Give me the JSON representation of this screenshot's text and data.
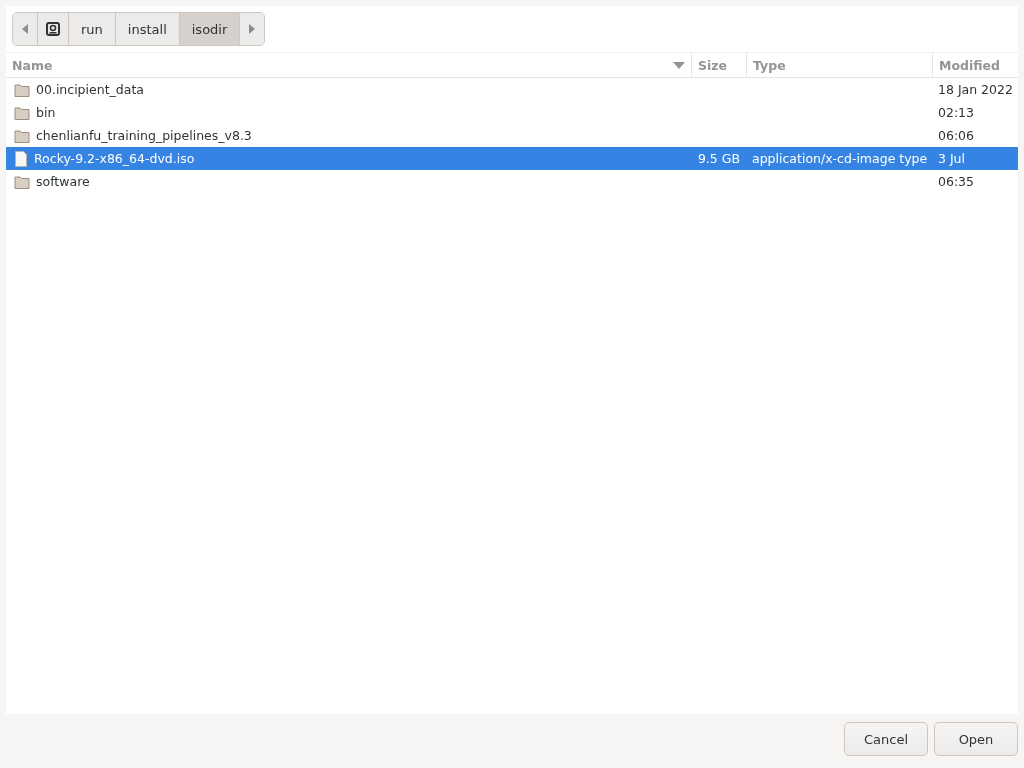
{
  "path_bar": {
    "crumbs": [
      {
        "kind": "drive",
        "selected": false
      },
      {
        "kind": "folder",
        "label": "run",
        "selected": false
      },
      {
        "kind": "folder",
        "label": "install",
        "selected": false
      },
      {
        "kind": "folder",
        "label": "isodir",
        "selected": true
      }
    ]
  },
  "table": {
    "columns": [
      "Name",
      "Size",
      "Type",
      "Modified"
    ],
    "rows": [
      {
        "kind": "folder",
        "name": "00.incipient_data",
        "size": "",
        "type": "",
        "modified": "18 Jan 2022",
        "selected": false
      },
      {
        "kind": "folder",
        "name": "bin",
        "modified": "02:13",
        "selected": false
      },
      {
        "kind": "folder",
        "name": "chenlianfu_training_pipelines_v8.3",
        "modified": "06:06",
        "selected": false
      },
      {
        "kind": "file",
        "name": "Rocky-9.2-x86_64-dvd.iso",
        "size": "9.5 GB",
        "type": "application/x-cd-image type",
        "modified": "3 Jul",
        "selected": true
      },
      {
        "kind": "folder",
        "name": "software",
        "modified": "06:35",
        "selected": false
      }
    ]
  },
  "buttons": [
    "Cancel",
    "Open"
  ]
}
